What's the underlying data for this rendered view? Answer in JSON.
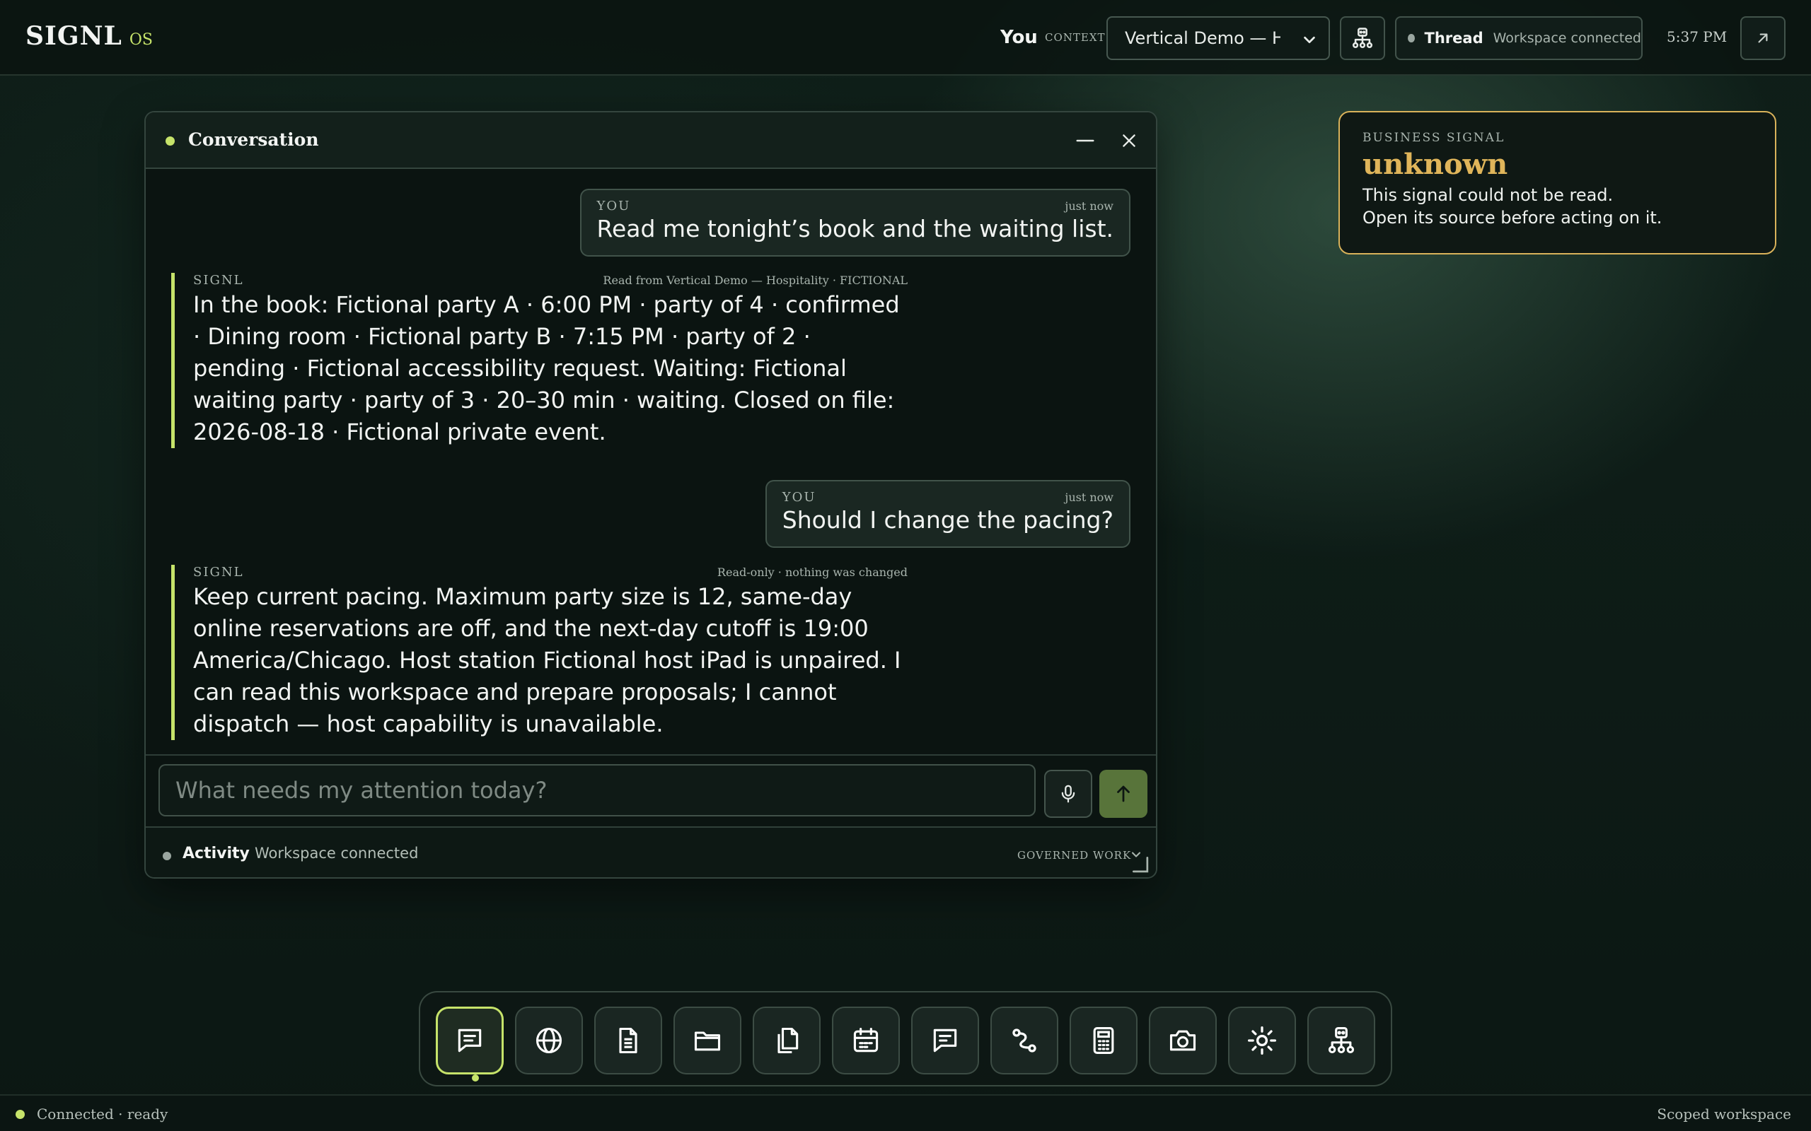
{
  "topbar": {
    "brand_name": "SIGNL",
    "brand_suffix": "OS",
    "user_label": "You",
    "context_label": "CONTEXT",
    "context_value": "Vertical Demo — H",
    "thread_title": "Thread",
    "thread_status": "Workspace connected",
    "clock": "5:37 PM"
  },
  "conversation": {
    "title": "Conversation",
    "messages": [
      {
        "who": "YOU",
        "when": "just now",
        "text": "Read me tonight’s book and the waiting list."
      },
      {
        "who": "SIGNL",
        "note": "Read from Vertical Demo — Hospitality · FICTIONAL",
        "text": "In the book: Fictional party A · 6:00 PM · party of 4 · confirmed · Dining room · Fictional party B · 7:15 PM · party of 2 · pending · Fictional accessibility request. Waiting: Fictional waiting party · party of 3 · 20–30 min · waiting. Closed on file: 2026-08-18 · Fictional private event."
      },
      {
        "who": "YOU",
        "when": "just now",
        "text": "Should I change the pacing?"
      },
      {
        "who": "SIGNL",
        "note": "Read-only · nothing was changed",
        "text": "Keep current pacing. Maximum party size is 12, same-day online reservations are off, and the next-day cutoff is 19:00 America/Chicago. Host station Fictional host iPad is unpaired. I can read this workspace and prepare proposals; I cannot dispatch — host capability is unavailable."
      }
    ],
    "composer_placeholder": "What needs my attention today?",
    "activity_title": "Activity",
    "activity_status": "Workspace connected",
    "governed_label": "GOVERNED WORK"
  },
  "signal_card": {
    "kicker": "BUSINESS SIGNAL",
    "value": "unknown",
    "line1": "This signal could not be read.",
    "line2": "Open its source before acting on it."
  },
  "dock": {
    "items": [
      {
        "icon": "chat-icon",
        "active": true
      },
      {
        "icon": "globe-icon"
      },
      {
        "icon": "document-icon"
      },
      {
        "icon": "folder-icon"
      },
      {
        "icon": "copy-icon"
      },
      {
        "icon": "calendar-icon"
      },
      {
        "icon": "message-icon"
      },
      {
        "icon": "route-icon"
      },
      {
        "icon": "calculator-icon"
      },
      {
        "icon": "camera-icon"
      },
      {
        "icon": "sun-icon"
      },
      {
        "icon": "network-icon"
      }
    ]
  },
  "statusbar": {
    "left": "Connected · ready",
    "right": "Scoped workspace"
  },
  "colors": {
    "accent": "#c6e36a",
    "signal_border": "#d9b25a",
    "signal_value": "#e0b55a",
    "send_button": "#58743a"
  }
}
